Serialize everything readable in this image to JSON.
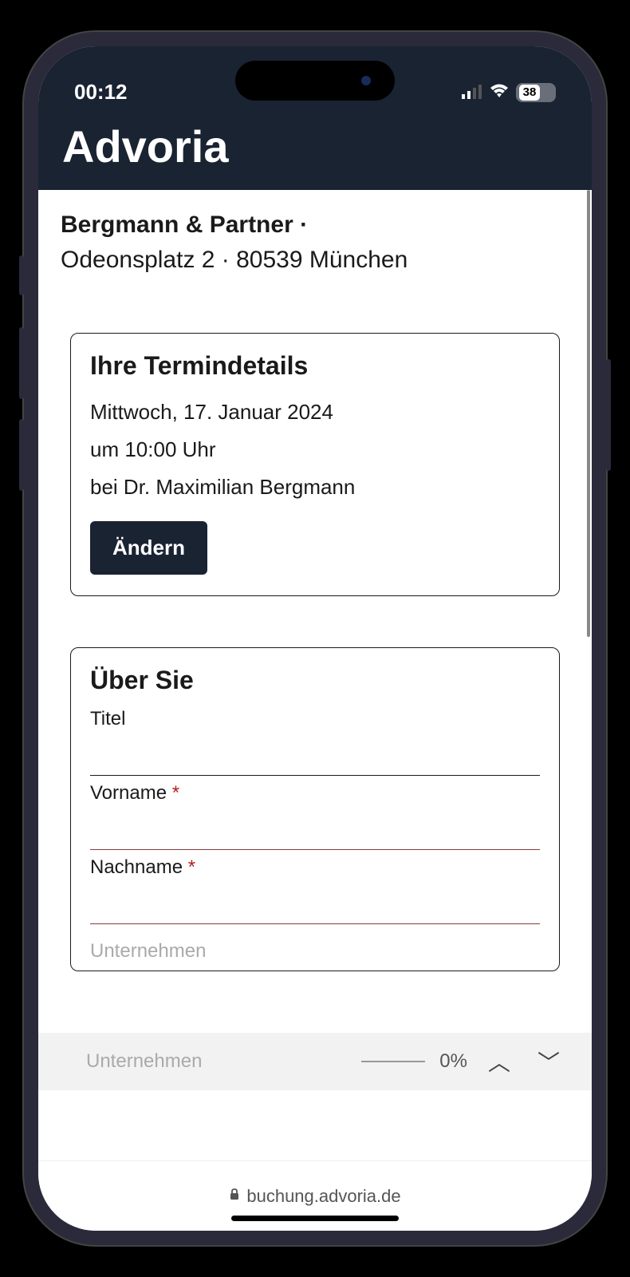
{
  "status": {
    "time": "00:12",
    "battery_percent": "38"
  },
  "header": {
    "app_name": "Advoria"
  },
  "company": {
    "name": "Bergmann & Partner",
    "separator": " ·",
    "address": "Odeonsplatz 2 · 80539 München"
  },
  "appointment": {
    "title": "Ihre Termindetails",
    "date": "Mittwoch, 17. Januar 2024",
    "time": "um 10:00 Uhr",
    "with": "bei Dr. Maximilian Bergmann",
    "change_button": "Ändern"
  },
  "form": {
    "title": "Über Sie",
    "fields": {
      "title_label": "Titel",
      "firstname_label": "Vorname",
      "lastname_label": "Nachname",
      "company_label": "Unternehmen"
    },
    "required_mark": "*"
  },
  "progress": {
    "percent": "0%"
  },
  "browser": {
    "url": "buchung.advoria.de"
  }
}
